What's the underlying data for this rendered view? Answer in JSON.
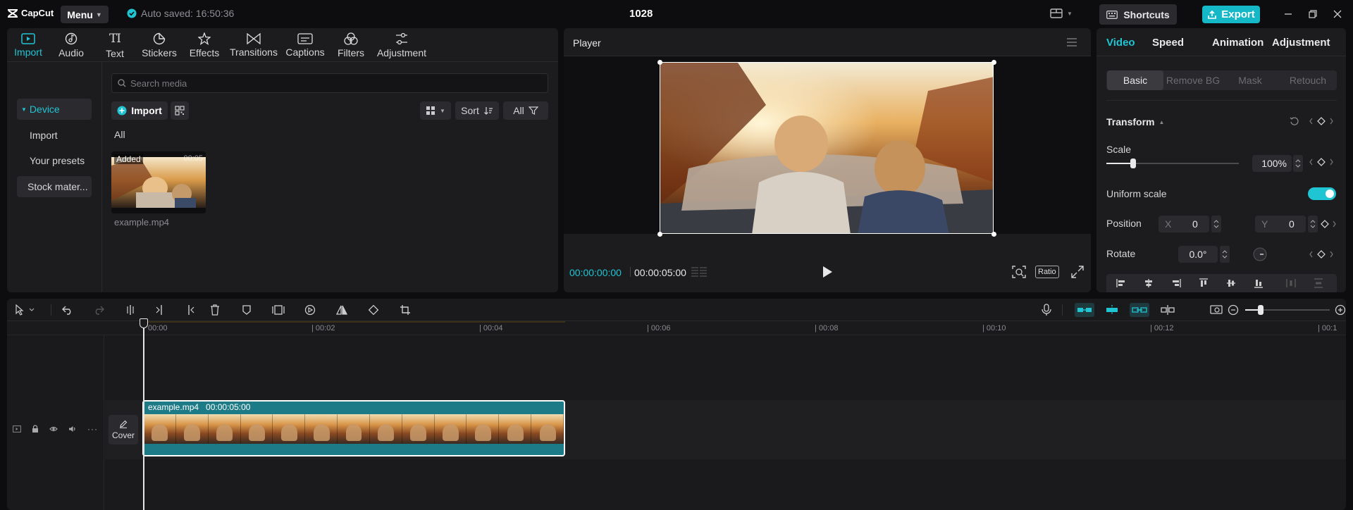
{
  "app": {
    "logo_text": "CapCut",
    "menu_label": "Menu",
    "autosave_text": "Auto saved: 16:50:36",
    "project_title": "1028",
    "shortcuts_label": "Shortcuts",
    "export_label": "Export"
  },
  "colors": {
    "accent": "#20c5d3",
    "export_bg": "#14b8c6",
    "clip": "#1c7b86"
  },
  "media": {
    "tabs": [
      {
        "label": "Import",
        "icon": "import-icon"
      },
      {
        "label": "Audio",
        "icon": "audio-icon"
      },
      {
        "label": "Text",
        "icon": "text-icon"
      },
      {
        "label": "Stickers",
        "icon": "stickers-icon"
      },
      {
        "label": "Effects",
        "icon": "effects-icon"
      },
      {
        "label": "Transitions",
        "icon": "transitions-icon"
      },
      {
        "label": "Captions",
        "icon": "captions-icon"
      },
      {
        "label": "Filters",
        "icon": "filters-icon"
      },
      {
        "label": "Adjustment",
        "icon": "adjustment-icon"
      }
    ],
    "side": {
      "device": "Device",
      "import": "Import",
      "presets": "Your presets",
      "stock": "Stock mater..."
    },
    "search_placeholder": "Search media",
    "import_button": "Import",
    "sort_label": "Sort",
    "filter_all": "All",
    "section_label": "All",
    "item": {
      "badge": "Added",
      "duration": "00:05",
      "filename": "example.mp4"
    }
  },
  "player": {
    "title": "Player",
    "current_time": "00:00:00:00",
    "total_time": "00:00:05:00",
    "ratio_label": "Ratio"
  },
  "props": {
    "tabs": [
      "Video",
      "Speed",
      "Animation",
      "Adjustment"
    ],
    "subtabs": [
      "Basic",
      "Remove BG",
      "Mask",
      "Retouch"
    ],
    "transform_label": "Transform",
    "scale_label": "Scale",
    "scale_value": "100%",
    "scale_fraction": 0.2,
    "uniform_label": "Uniform scale",
    "position_label": "Position",
    "pos_x_label": "X",
    "pos_x_value": "0",
    "pos_y_label": "Y",
    "pos_y_value": "0",
    "rotate_label": "Rotate",
    "rotate_value": "0.0°"
  },
  "timeline": {
    "ticks": [
      "00:00",
      "| 00:02",
      "| 00:04",
      "| 00:06",
      "| 00:08",
      "| 00:10",
      "| 00:12",
      "| 00:1"
    ],
    "clip_name": "example.mp4",
    "clip_duration": "00:00:05:00",
    "cover_label": "Cover"
  }
}
